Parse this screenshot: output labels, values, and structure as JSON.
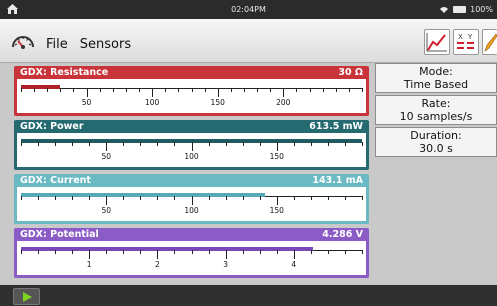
{
  "statusbar": {
    "time": "02:04PM",
    "battery": "100%",
    "icons": [
      "home-icon",
      "wifi-icon",
      "battery-icon"
    ]
  },
  "toolbar": {
    "menu": {
      "file": "File",
      "sensors": "Sensors"
    },
    "tools": [
      "graph-view-icon",
      "table-view-icon",
      "pencil-icon"
    ]
  },
  "meters": [
    {
      "name": "GDX: Resistance",
      "value": "30 Ω",
      "color": "#c8343a",
      "min": 0,
      "max": 260,
      "fill_value": 30,
      "fill_color": "#b02028",
      "labels": [
        "50",
        "100",
        "150",
        "200"
      ],
      "label_values": [
        50,
        100,
        150,
        200
      ],
      "minor_step": 10
    },
    {
      "name": "GDX: Power",
      "value": "613.5 mW",
      "color": "#246a70",
      "min": 0,
      "max": 200,
      "fill_value": 200,
      "fill_color": "#1f5b61",
      "labels": [
        "50",
        "100",
        "150"
      ],
      "label_values": [
        50,
        100,
        150
      ],
      "minor_step": 10
    },
    {
      "name": "GDX: Current",
      "value": "143.1 mA",
      "color": "#6ab9c3",
      "min": 0,
      "max": 200,
      "fill_value": 143.1,
      "fill_color": "#5aaab5",
      "labels": [
        "50",
        "100",
        "150"
      ],
      "label_values": [
        50,
        100,
        150
      ],
      "minor_step": 10
    },
    {
      "name": "GDX: Potential",
      "value": "4.286 V",
      "color": "#8c5cc6",
      "min": 0,
      "max": 5,
      "fill_value": 4.286,
      "fill_color": "#7a48b8",
      "labels": [
        "1",
        "2",
        "3",
        "4"
      ],
      "label_values": [
        1,
        2,
        3,
        4
      ],
      "minor_step": 0.25
    }
  ],
  "settings": {
    "mode": {
      "label": "Mode:",
      "value": "Time Based"
    },
    "rate": {
      "label": "Rate:",
      "value": "10 samples/s"
    },
    "duration": {
      "label": "Duration:",
      "value": "30.0 s"
    }
  },
  "bottombar": {
    "play_icon": "play-icon"
  }
}
